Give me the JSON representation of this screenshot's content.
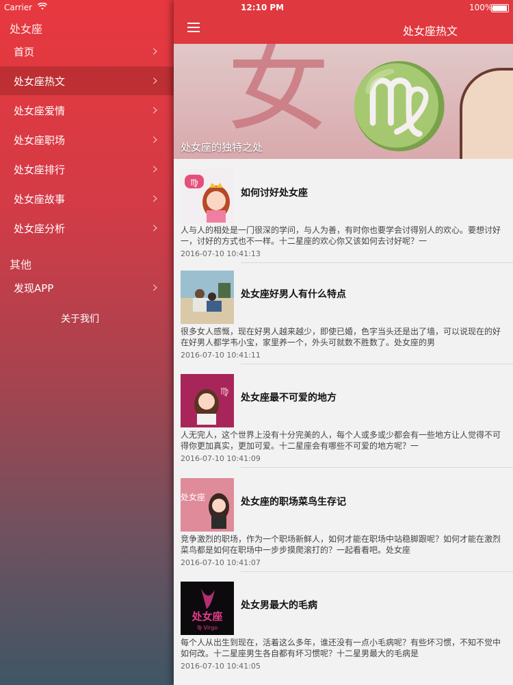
{
  "status": {
    "carrier": "Carrier",
    "time": "12:10 PM",
    "battery": "100%"
  },
  "drawer": {
    "section1_title": "处女座",
    "items": [
      {
        "label": "首页"
      },
      {
        "label": "处女座热文"
      },
      {
        "label": "处女座爱情"
      },
      {
        "label": "处女座职场"
      },
      {
        "label": "处女座排行"
      },
      {
        "label": "处女座故事"
      },
      {
        "label": "处女座分析"
      }
    ],
    "section2_title": "其他",
    "discover": "发现APP",
    "about": "关于我们",
    "chevron": "›"
  },
  "nav": {
    "title": "处女座热文"
  },
  "hero": {
    "caption": "处女座的独特之处",
    "glyph1": "女",
    "glyph2": "♍"
  },
  "articles": [
    {
      "title": "如何讨好处女座",
      "excerpt1": "人与人的相处是一门很深的学问，与人为善，有时你也要学会讨得别人的欢心。要想讨好",
      "excerpt2": "一，讨好的方式也不一样。十二星座的欢心你又该如何去讨好呢？一",
      "date": "2016-07-10 10:41:13"
    },
    {
      "title": "处女座好男人有什么特点",
      "excerpt1": "很多女人感慨，现在好男人越来越少，即使已婚，色字当头还是出了墙，可以说现在的好",
      "excerpt2": "在好男人都学韦小宝，家里养一个，外头可就数不胜数了。处女座的男",
      "date": "2016-07-10 10:41:11"
    },
    {
      "title": "处女座最不可爱的地方",
      "excerpt1": "人无完人，这个世界上没有十分完美的人，每个人或多或少都会有一些地方让人觉得不可",
      "excerpt2": "得你更加真实，更加可爱。十二星座会有哪些不可爱的地方呢？一",
      "date": "2016-07-10 10:41:09"
    },
    {
      "title": "处女座的职场菜鸟生存记",
      "excerpt1": "竞争激烈的职场，作为一个职场新鲜人，如何才能在职场中站稳脚跟呢？如何才能在激烈",
      "excerpt2": "菜鸟都是如何在职场中一步步摸爬滚打的？一起看看吧。处女座",
      "date": "2016-07-10 10:41:07"
    },
    {
      "title": "处女男最大的毛病",
      "excerpt1": "每个人从出生到现在，活着这么多年，谁还没有一点小毛病呢？有些坏习惯，不知不觉中",
      "excerpt2": "如何改。十二星座男生各自都有坏习惯呢？十二星男最大的毛病是",
      "date": "2016-07-10 10:41:05"
    }
  ],
  "thumb_text": {
    "t4": "处女座",
    "t5a": "处女座",
    "t5b": "♍ Virgo",
    "t3": "♍"
  }
}
